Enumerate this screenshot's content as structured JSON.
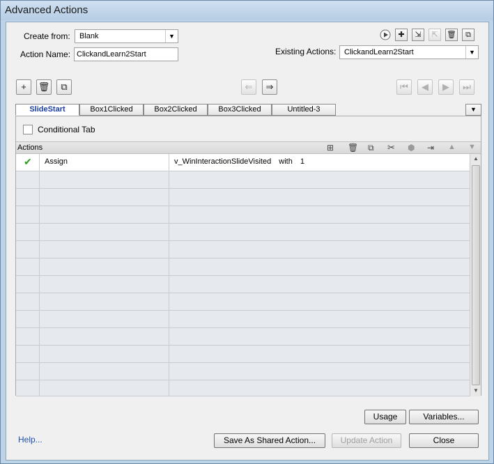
{
  "window": {
    "title": "Advanced Actions"
  },
  "form": {
    "create_from_label": "Create from:",
    "create_from_value": "Blank",
    "action_name_label": "Action Name:",
    "action_name_value": "ClickandLearn2Start",
    "existing_actions_label": "Existing Actions:",
    "existing_actions_value": "ClickandLearn2Start"
  },
  "tabs": [
    {
      "label": "SlideStart",
      "active": true
    },
    {
      "label": "Box1Clicked",
      "active": false
    },
    {
      "label": "Box2Clicked",
      "active": false
    },
    {
      "label": "Box3Clicked",
      "active": false
    },
    {
      "label": "Untitled-3",
      "active": false
    }
  ],
  "conditional": {
    "label": "Conditional Tab",
    "checked": false
  },
  "actions_table": {
    "header": "Actions",
    "rows": [
      {
        "status": "check",
        "action": "Assign",
        "target": "v_WinInteractionSlideVisited",
        "op": "with",
        "value": "1"
      }
    ],
    "empty_rows": 13
  },
  "buttons": {
    "usage": "Usage",
    "variables": "Variables...",
    "help": "Help...",
    "save_shared": "Save As Shared Action...",
    "update": "Update Action",
    "close": "Close"
  }
}
